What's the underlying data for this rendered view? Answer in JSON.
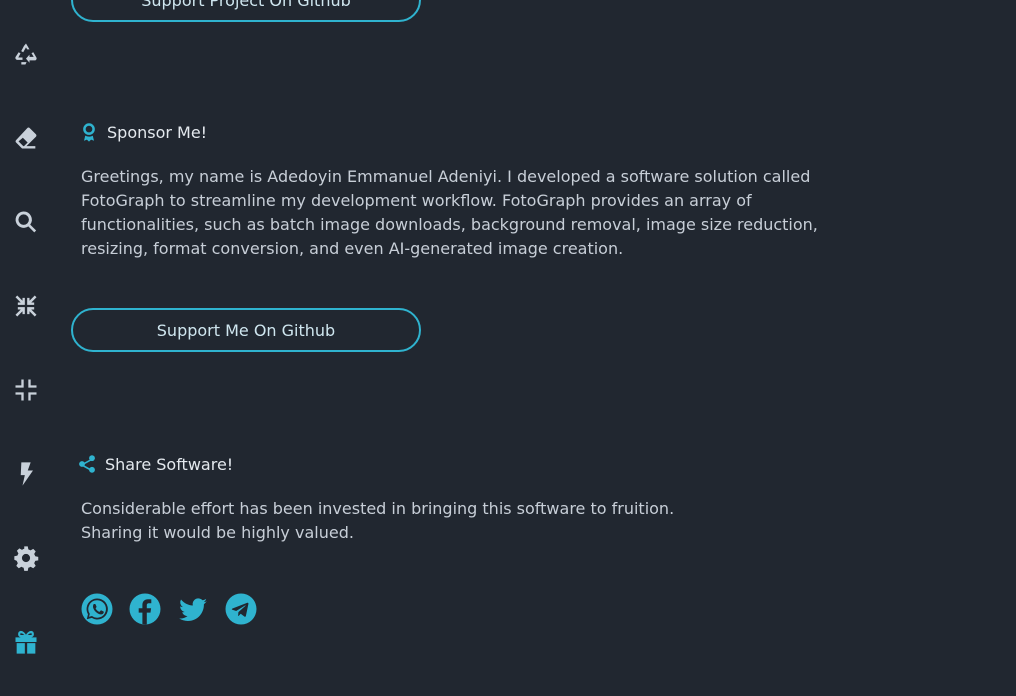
{
  "accent_color": "#2fb3cf",
  "sidebar": {
    "items": [
      {
        "icon": "recycle-icon"
      },
      {
        "icon": "eraser-icon"
      },
      {
        "icon": "search-icon"
      },
      {
        "icon": "compress-arrows-icon"
      },
      {
        "icon": "compress-icon"
      },
      {
        "icon": "bolt-icon"
      },
      {
        "icon": "gear-icon"
      },
      {
        "icon": "gift-icon"
      }
    ]
  },
  "top_button": {
    "label": "Support Project On Github"
  },
  "sponsor": {
    "title": "Sponsor Me!",
    "text": "Greetings, my name is Adedoyin Emmanuel Adeniyi. I developed a software solution called FotoGraph to streamline my development workflow. FotoGraph provides an array of functionalities, such as batch image downloads, background removal, image size reduction, resizing, format conversion, and even AI-generated image creation.",
    "button_label": "Support Me On Github"
  },
  "share": {
    "title": "Share Software!",
    "text_line1": "Considerable effort has been invested in bringing this software to fruition.",
    "text_line2": "Sharing it would be highly valued.",
    "targets": [
      "whatsapp-icon",
      "facebook-icon",
      "twitter-icon",
      "telegram-icon"
    ]
  }
}
